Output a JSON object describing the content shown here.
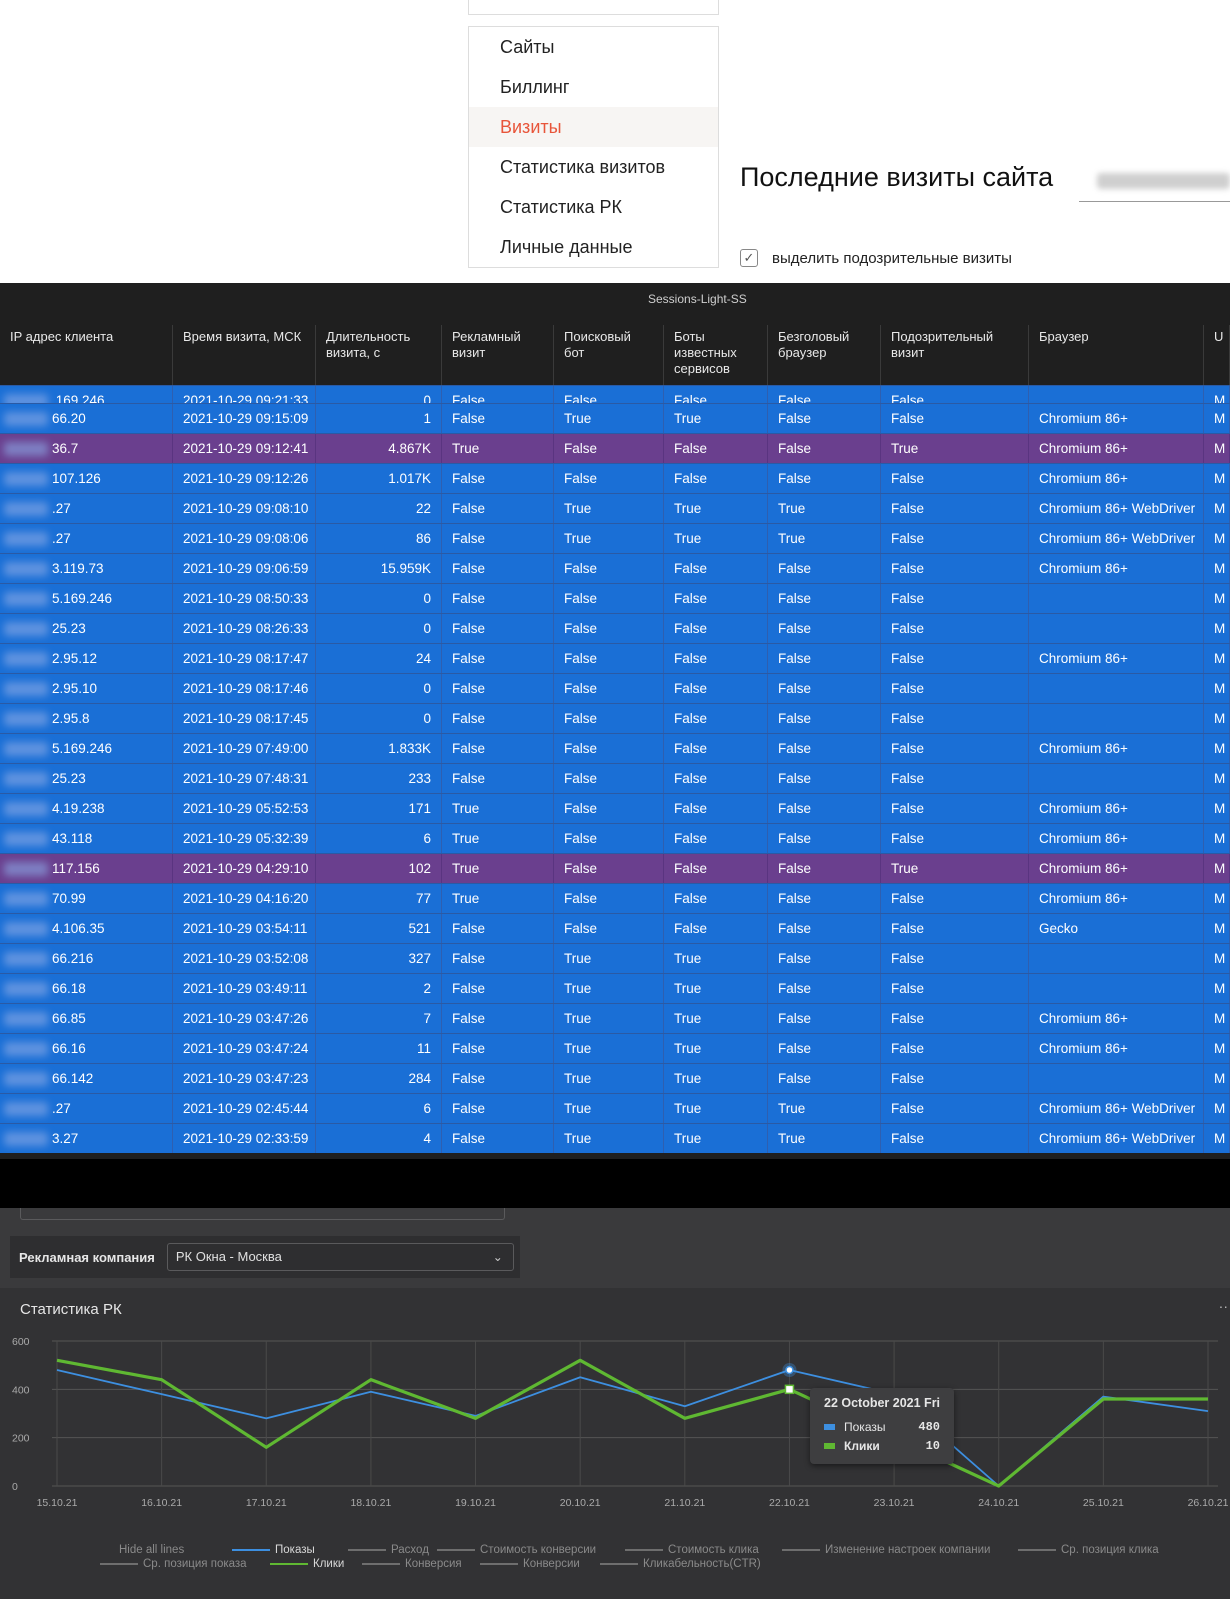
{
  "menu": {
    "items": [
      {
        "label": "Сайты",
        "active": false
      },
      {
        "label": "Биллинг",
        "active": false
      },
      {
        "label": "Визиты",
        "active": true
      },
      {
        "label": "Статистика визитов",
        "active": false
      },
      {
        "label": "Статистика РК",
        "active": false
      },
      {
        "label": "Личные данные",
        "active": false
      }
    ]
  },
  "page": {
    "heading": "Последние визиты сайта",
    "highlight_checkbox_label": "выделить подозрительные визиты",
    "highlight_checked": true
  },
  "table": {
    "title": "Sessions-Light-SS",
    "columns": [
      "IP адрес клиента",
      "Время визита, МСК",
      "Длительность визита, с",
      "Рекламный визит",
      "Поисковый бот",
      "Боты известных сервисов",
      "Безголовый браузер",
      "Подозрительный визит",
      "Браузер",
      "U"
    ],
    "partial_row": {
      "ip": ".169.246",
      "time": "2021-10-29 09:21:33",
      "duration": "0",
      "ad": "False",
      "bot": "False",
      "known": "False",
      "headless": "False",
      "susp": "False",
      "browser": "",
      "u": "M"
    },
    "rows": [
      {
        "ip": "66.20",
        "time": "2021-10-29 09:15:09",
        "duration": "1",
        "ad": "False",
        "bot": "True",
        "known": "True",
        "headless": "False",
        "susp": "False",
        "browser": "Chromium 86+",
        "u": "M"
      },
      {
        "ip": "36.7",
        "time": "2021-10-29 09:12:41",
        "duration": "4.867K",
        "ad": "True",
        "bot": "False",
        "known": "False",
        "headless": "False",
        "susp": "True",
        "browser": "Chromium 86+",
        "u": "M"
      },
      {
        "ip": "107.126",
        "time": "2021-10-29 09:12:26",
        "duration": "1.017K",
        "ad": "False",
        "bot": "False",
        "known": "False",
        "headless": "False",
        "susp": "False",
        "browser": "Chromium 86+",
        "u": "M"
      },
      {
        "ip": ".27",
        "time": "2021-10-29 09:08:10",
        "duration": "22",
        "ad": "False",
        "bot": "True",
        "known": "True",
        "headless": "True",
        "susp": "False",
        "browser": "Chromium 86+ WebDriver",
        "u": "M"
      },
      {
        "ip": ".27",
        "time": "2021-10-29 09:08:06",
        "duration": "86",
        "ad": "False",
        "bot": "True",
        "known": "True",
        "headless": "True",
        "susp": "False",
        "browser": "Chromium 86+ WebDriver",
        "u": "M"
      },
      {
        "ip": "3.119.73",
        "time": "2021-10-29 09:06:59",
        "duration": "15.959K",
        "ad": "False",
        "bot": "False",
        "known": "False",
        "headless": "False",
        "susp": "False",
        "browser": "Chromium 86+",
        "u": "M"
      },
      {
        "ip": "5.169.246",
        "time": "2021-10-29 08:50:33",
        "duration": "0",
        "ad": "False",
        "bot": "False",
        "known": "False",
        "headless": "False",
        "susp": "False",
        "browser": "",
        "u": "M"
      },
      {
        "ip": "25.23",
        "time": "2021-10-29 08:26:33",
        "duration": "0",
        "ad": "False",
        "bot": "False",
        "known": "False",
        "headless": "False",
        "susp": "False",
        "browser": "",
        "u": "M"
      },
      {
        "ip": "2.95.12",
        "time": "2021-10-29 08:17:47",
        "duration": "24",
        "ad": "False",
        "bot": "False",
        "known": "False",
        "headless": "False",
        "susp": "False",
        "browser": "Chromium 86+",
        "u": "M"
      },
      {
        "ip": "2.95.10",
        "time": "2021-10-29 08:17:46",
        "duration": "0",
        "ad": "False",
        "bot": "False",
        "known": "False",
        "headless": "False",
        "susp": "False",
        "browser": "",
        "u": "M"
      },
      {
        "ip": "2.95.8",
        "time": "2021-10-29 08:17:45",
        "duration": "0",
        "ad": "False",
        "bot": "False",
        "known": "False",
        "headless": "False",
        "susp": "False",
        "browser": "",
        "u": "M"
      },
      {
        "ip": "5.169.246",
        "time": "2021-10-29 07:49:00",
        "duration": "1.833K",
        "ad": "False",
        "bot": "False",
        "known": "False",
        "headless": "False",
        "susp": "False",
        "browser": "Chromium 86+",
        "u": "M"
      },
      {
        "ip": "25.23",
        "time": "2021-10-29 07:48:31",
        "duration": "233",
        "ad": "False",
        "bot": "False",
        "known": "False",
        "headless": "False",
        "susp": "False",
        "browser": "",
        "u": "M"
      },
      {
        "ip": "4.19.238",
        "time": "2021-10-29 05:52:53",
        "duration": "171",
        "ad": "True",
        "bot": "False",
        "known": "False",
        "headless": "False",
        "susp": "False",
        "browser": "Chromium 86+",
        "u": "M"
      },
      {
        "ip": "43.118",
        "time": "2021-10-29 05:32:39",
        "duration": "6",
        "ad": "True",
        "bot": "False",
        "known": "False",
        "headless": "False",
        "susp": "False",
        "browser": "Chromium 86+",
        "u": "M"
      },
      {
        "ip": "117.156",
        "time": "2021-10-29 04:29:10",
        "duration": "102",
        "ad": "True",
        "bot": "False",
        "known": "False",
        "headless": "False",
        "susp": "True",
        "browser": "Chromium 86+",
        "u": "M"
      },
      {
        "ip": "70.99",
        "time": "2021-10-29 04:16:20",
        "duration": "77",
        "ad": "True",
        "bot": "False",
        "known": "False",
        "headless": "False",
        "susp": "False",
        "browser": "Chromium 86+",
        "u": "M"
      },
      {
        "ip": "4.106.35",
        "time": "2021-10-29 03:54:11",
        "duration": "521",
        "ad": "False",
        "bot": "False",
        "known": "False",
        "headless": "False",
        "susp": "False",
        "browser": "Gecko",
        "u": "M"
      },
      {
        "ip": "66.216",
        "time": "2021-10-29 03:52:08",
        "duration": "327",
        "ad": "False",
        "bot": "True",
        "known": "True",
        "headless": "False",
        "susp": "False",
        "browser": "",
        "u": "M"
      },
      {
        "ip": "66.18",
        "time": "2021-10-29 03:49:11",
        "duration": "2",
        "ad": "False",
        "bot": "True",
        "known": "True",
        "headless": "False",
        "susp": "False",
        "browser": "",
        "u": "M"
      },
      {
        "ip": "66.85",
        "time": "2021-10-29 03:47:26",
        "duration": "7",
        "ad": "False",
        "bot": "True",
        "known": "True",
        "headless": "False",
        "susp": "False",
        "browser": "Chromium 86+",
        "u": "M"
      },
      {
        "ip": "66.16",
        "time": "2021-10-29 03:47:24",
        "duration": "11",
        "ad": "False",
        "bot": "True",
        "known": "True",
        "headless": "False",
        "susp": "False",
        "browser": "Chromium 86+",
        "u": "M"
      },
      {
        "ip": "66.142",
        "time": "2021-10-29 03:47:23",
        "duration": "284",
        "ad": "False",
        "bot": "True",
        "known": "True",
        "headless": "False",
        "susp": "False",
        "browser": "",
        "u": "M"
      },
      {
        "ip": ".27",
        "time": "2021-10-29 02:45:44",
        "duration": "6",
        "ad": "False",
        "bot": "True",
        "known": "True",
        "headless": "True",
        "susp": "False",
        "browser": "Chromium 86+ WebDriver",
        "u": "M"
      },
      {
        "ip": "3.27",
        "time": "2021-10-29 02:33:59",
        "duration": "4",
        "ad": "False",
        "bot": "True",
        "known": "True",
        "headless": "True",
        "susp": "False",
        "browser": "Chromium 86+ WebDriver",
        "u": "M"
      }
    ]
  },
  "filters": {
    "campaign_label": "Рекламная компания",
    "campaign_value": "РК Окна - Москва"
  },
  "stats_card": {
    "title": "Статистика РК",
    "more": "··"
  },
  "tooltip": {
    "date": "22 October 2021 Fri",
    "rows": [
      {
        "name": "Показы",
        "value": "480",
        "color": "#3d8fe0"
      },
      {
        "name": "Клики",
        "value": "10",
        "color": "#5fb832"
      }
    ]
  },
  "legend": {
    "row1": [
      "Hide all lines",
      "Показы",
      "Расход",
      "Стоимость конверсии",
      "Стоимость клика",
      "Изменение настроек компании",
      "Ср. позиция клика"
    ],
    "row2": [
      "Ср. позиция показа",
      "Клики",
      "Конверсия",
      "Конверсии",
      "Кликабельность(CTR)"
    ],
    "active": [
      "Показы",
      "Клики"
    ]
  },
  "colors": {
    "row_normal": "#1a6fd6",
    "row_suspicious": "#6a3f8e",
    "accent_menu": "#e8553a",
    "series_shows": "#3d8fe0",
    "series_clicks": "#5fb832"
  },
  "chart_data": {
    "type": "line",
    "x": [
      "15.10.21",
      "16.10.21",
      "17.10.21",
      "18.10.21",
      "19.10.21",
      "20.10.21",
      "21.10.21",
      "22.10.21",
      "23.10.21",
      "24.10.21",
      "25.10.21",
      "26.10.21"
    ],
    "ylim": [
      0,
      600
    ],
    "yticks": [
      0,
      200,
      400,
      600
    ],
    "series": [
      {
        "name": "Показы",
        "values": [
          480,
          380,
          280,
          390,
          290,
          450,
          330,
          480,
          380,
          0,
          370,
          310
        ]
      },
      {
        "name": "Клики",
        "values": [
          520,
          440,
          160,
          440,
          280,
          520,
          280,
          400,
          200,
          0,
          360,
          360
        ]
      }
    ],
    "grid": true
  }
}
